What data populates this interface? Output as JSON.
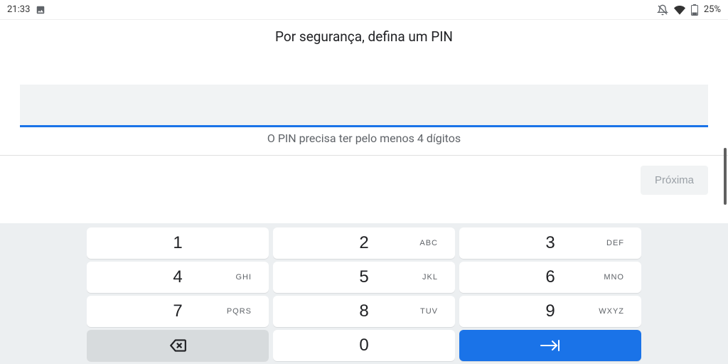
{
  "status": {
    "time": "21:33",
    "battery": "25%"
  },
  "title": "Por segurança, defina um PIN",
  "hint": "O PIN precisa ter pelo menos 4 dígitos",
  "pin_value": "",
  "next_label": "Próxima",
  "keypad": {
    "k1": "1",
    "k2": "2",
    "k3": "3",
    "k4": "4",
    "k5": "5",
    "k6": "6",
    "k7": "7",
    "k8": "8",
    "k9": "9",
    "k0": "0",
    "l2": "ABC",
    "l3": "DEF",
    "l4": "GHI",
    "l5": "JKL",
    "l6": "MNO",
    "l7": "PQRS",
    "l8": "TUV",
    "l9": "WXYZ"
  }
}
